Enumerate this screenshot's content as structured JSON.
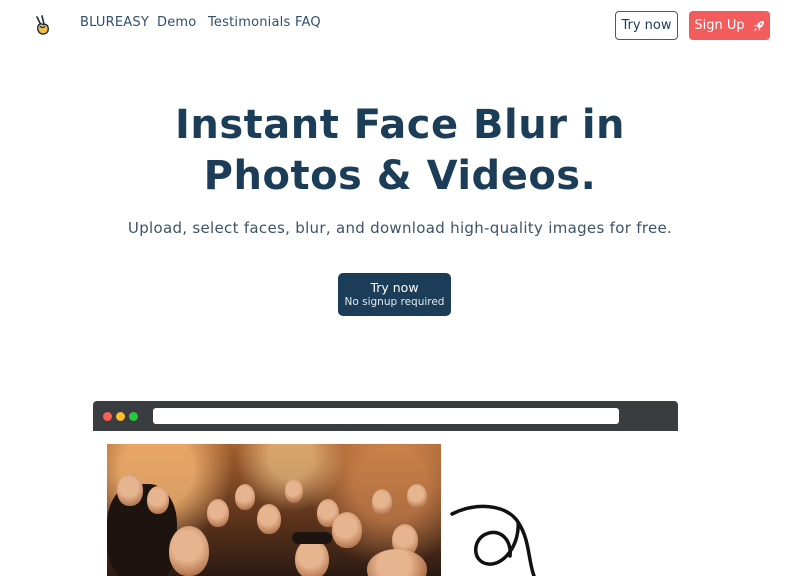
{
  "nav": {
    "brand": "BLUREASY",
    "links": [
      "Demo",
      "Testimonials",
      "FAQ"
    ],
    "try_now": "Try now",
    "sign_up": "Sign Up"
  },
  "hero": {
    "title_line1": "Instant Face Blur in",
    "title_line2": "Photos & Videos.",
    "subtitle": "Upload, select faces, blur, and download high-quality images for free.",
    "cta_line1": "Try now",
    "cta_line2": "No signup required"
  },
  "icons": {
    "logo": "victory-hand-icon",
    "sign_up": "rocket-icon"
  },
  "colors": {
    "primary": "#1c3d57",
    "accent": "#f25c5c",
    "browser_bar": "#3a3d40",
    "dot_red": "#ff5f57",
    "dot_yellow": "#febc2e",
    "dot_green": "#28c840"
  }
}
